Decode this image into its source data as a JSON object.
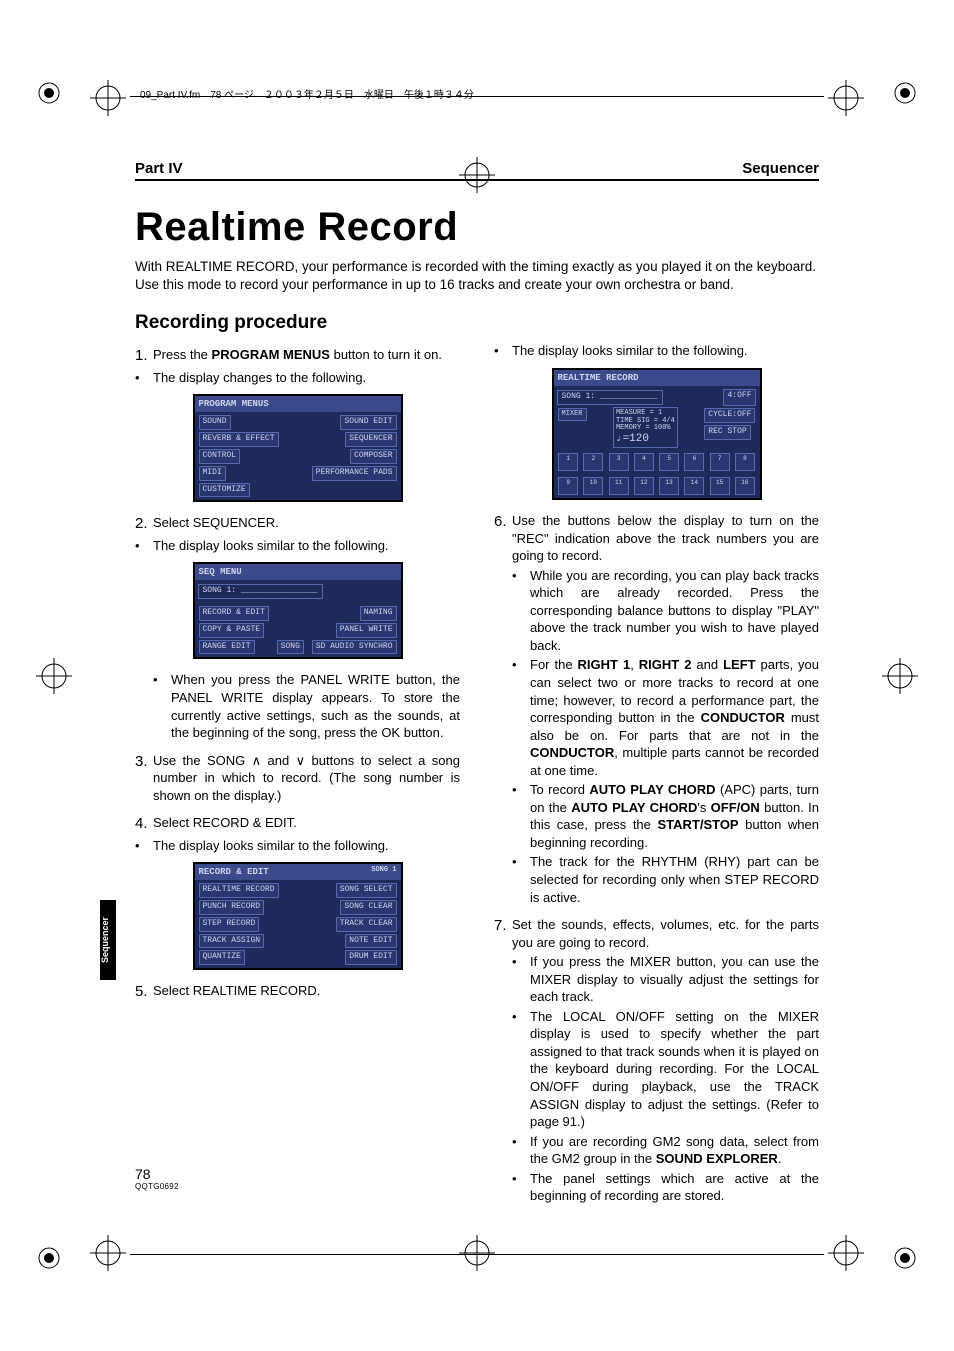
{
  "meta": {
    "top_note": "09_Part IV.fm　78 ページ　２００３年２月５日　水曜日　午後１時３４分"
  },
  "header": {
    "left": "Part IV",
    "right": "Sequencer"
  },
  "title": "Realtime Record",
  "intro": "With REALTIME RECORD, your performance is recorded with the timing exactly as you played it on the keyboard. Use this mode to record your performance in up to 16 tracks and create your own orchestra or band.",
  "subhead": "Recording procedure",
  "left_col": {
    "step1_pre": "Press the ",
    "step1_bold": "PROGRAM MENUS",
    "step1_post": " button to turn it on.",
    "step1_bullet": "The display changes to the following.",
    "lcd1": {
      "title": "PROGRAM MENUS",
      "left": [
        "SOUND",
        "REVERB & EFFECT",
        "CONTROL",
        "MIDI",
        "CUSTOMIZE"
      ],
      "right": [
        "SOUND EDIT",
        "SEQUENCER",
        "COMPOSER",
        "PERFORMANCE PADS"
      ]
    },
    "step2": "Select SEQUENCER.",
    "step2_bullet": "The display looks similar to the following.",
    "lcd2": {
      "title": "SEQ MENU",
      "song": "SONG 1:",
      "left": [
        "RECORD & EDIT",
        "COPY & PASTE",
        "RANGE EDIT"
      ],
      "center": "SONG",
      "right": [
        "NAMING",
        "PANEL WRITE",
        "SD AUDIO SYNCHRO"
      ]
    },
    "panelwrite_bullet": "When you press the PANEL WRITE button, the PANEL WRITE display appears. To store the currently active settings, such as the sounds, at the beginning of the song, press the OK button.",
    "step3": "Use the SONG ∧ and ∨ buttons to select a song number in which to record. (The song number is shown on the display.)",
    "step4": "Select RECORD & EDIT.",
    "step4_bullet": "The display looks similar to the following.",
    "lcd3": {
      "title": "RECORD & EDIT",
      "song": "SONG 1",
      "left": [
        "REALTIME RECORD",
        "PUNCH RECORD",
        "STEP RECORD",
        "TRACK ASSIGN",
        "QUANTIZE"
      ],
      "right": [
        "SONG SELECT",
        "SONG CLEAR",
        "TRACK CLEAR",
        "NOTE EDIT",
        "DRUM EDIT"
      ]
    },
    "step5": "Select REALTIME RECORD."
  },
  "right_col": {
    "top_bullet": "The display looks similar to the following.",
    "lcd4": {
      "title": "REALTIME RECORD",
      "song": "SONG 1:",
      "info1": "MEASURE = 1",
      "info2": "TIME SIG = 4/4",
      "info3": "MEMORY = 100%",
      "tempo": "♩=120",
      "right1": "4:OFF",
      "right2": "CYCLE:OFF",
      "right3": "REC STOP",
      "left_btn": "MIXER",
      "tracks_top": [
        "1",
        "2",
        "3",
        "4",
        "5",
        "6",
        "7",
        "8"
      ],
      "tracks_bot": [
        "9",
        "10",
        "11",
        "12",
        "13",
        "14",
        "15",
        "16"
      ]
    },
    "step6": "Use the buttons below the display to turn on the \"REC\" indication above the track numbers you are going to record.",
    "step6_b1": "While you are recording, you can play back tracks which are already recorded. Press the corresponding balance buttons to display \"PLAY\" above the track number you wish to have played back.",
    "step6_b2_pre": "For the ",
    "step6_b2_r1": "RIGHT 1",
    "step6_b2_mid1": ", ",
    "step6_b2_r2": "RIGHT 2",
    "step6_b2_mid2": " and ",
    "step6_b2_left": "LEFT",
    "step6_b2_post1": " parts, you can select two or more tracks to record at one time; however, to record a performance part, the corresponding button in the ",
    "step6_b2_cond": "CON­DUCTOR",
    "step6_b2_post2": " must also be on. For parts that are not in the ",
    "step6_b2_cond2": "CONDUCTOR",
    "step6_b2_post3": ", multiple parts can­not be recorded at one time.",
    "step6_b3_pre": "To record ",
    "step6_b3_apc": "AUTO PLAY CHORD",
    "step6_b3_mid1": " (APC) parts, turn on the ",
    "step6_b3_apc2": "AUTO PLAY CHORD",
    "step6_b3_mid2": "'s ",
    "step6_b3_offon": "OFF/ON",
    "step6_b3_mid3": " button. In this case, press the ",
    "step6_b3_ss": "START/STOP",
    "step6_b3_post": " button when beginning recording.",
    "step6_b4": "The track for the RHYTHM (RHY) part can be selected for recording only when STEP RECORD is active.",
    "step7": "Set the sounds, effects, volumes, etc. for the parts you are going to record.",
    "step7_b1": "If you press the MIXER button, you can use the MIXER display to visually adjust the set­tings for each track.",
    "step7_b2": "The LOCAL ON/OFF setting on the MIXER display is used to specify whether the part assigned to that track sounds when it is played on the keyboard during recording. For the LOCAL ON/OFF during playback, use the TRACK ASSIGN display to adjust the settings. (Refer to page 91.)",
    "step7_b3_pre": "If you are recording GM2 song data, select from the GM2 group in the ",
    "step7_b3_se": "SOUND EXPLORER",
    "step7_b3_post": ".",
    "step7_b4": "The panel settings which are active at the beginning of recording are stored."
  },
  "sidebar": "Sequencer",
  "footer": {
    "page": "78",
    "code": "QQTG0692"
  }
}
